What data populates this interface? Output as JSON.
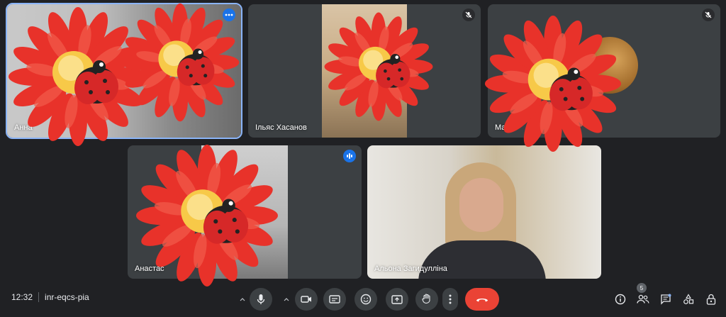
{
  "meeting": {
    "time": "12:32",
    "code": "inr-eqcs-pia"
  },
  "participants": [
    {
      "name": "Анна",
      "muted": false
    },
    {
      "name": "Ільяс Хасанов",
      "muted": true
    },
    {
      "name": "Мар",
      "muted": true
    },
    {
      "name": "Анастас",
      "muted": false,
      "speaking": true
    },
    {
      "name": "Альона Загидулліна",
      "muted": false
    }
  ],
  "controls": {
    "people_count": "5"
  },
  "colors": {
    "background": "#202124",
    "tile": "#3c4043",
    "accent": "#8ab4f8",
    "hangup": "#ea4335",
    "speaking": "#1a73e8"
  },
  "icons": {
    "mic": "mic-icon",
    "camera": "camera-icon",
    "captions": "captions-icon",
    "emoji": "emoji-icon",
    "present": "present-icon",
    "hand": "raise-hand-icon",
    "more": "more-options-icon",
    "hangup": "hang-up-icon",
    "info": "info-icon",
    "people": "people-icon",
    "chat": "chat-icon",
    "activities": "activities-icon",
    "lock": "host-controls-icon"
  }
}
